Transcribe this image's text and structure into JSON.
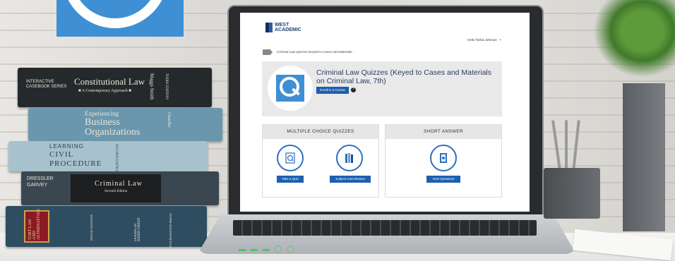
{
  "brand": {
    "line1": "WEST",
    "line2": "ACADEMIC"
  },
  "header": {
    "user_greeting": "Hello Tasha Johnson"
  },
  "breadcrumb": {
    "text": "Criminal Law Quizzes (Keyed to Cases and Materials..."
  },
  "course": {
    "title": "Criminal Law Quizzes (Keyed to Cases and Materials on Criminal Law, 7th)",
    "enroll_label": "Enroll in a Course",
    "help_label": "?"
  },
  "panels": {
    "mcq": {
      "title": "MULTIPLE CHOICE QUIZZES",
      "take_quiz_label": "Take a Quiz",
      "review_label": "Subject Area Review"
    },
    "short": {
      "title": "SHORT ANSWER",
      "view_label": "View Questions"
    }
  },
  "books": [
    {
      "series": "INTERACTIVE CASEBOOK SERIES",
      "title": "Constitutional Law",
      "subtitle": "■ A Contemporary Approach ■",
      "authors": "Maggs Smith",
      "edition": "THIRD EDITION"
    },
    {
      "title_line1": "Experiencing",
      "title_line2": "Business",
      "title_line3": "Organizations",
      "authors": "Chandler"
    },
    {
      "title_line1": "LEARNING",
      "title_line2": "CIVIL",
      "title_line3": "PROCEDURE",
      "edition": "SECOND EDITION"
    },
    {
      "authors": "DRESSLER GARVEY",
      "title": "Criminal Law",
      "subtitle": "Seventh Edition"
    },
    {
      "title": "TORT LAW AND ALTERNATIVES",
      "edition": "NINTH EDITION",
      "authors": "FRANKLIN RABIN GREEN",
      "publisher": "FOUNDATION PRESS"
    }
  ],
  "colors": {
    "accent": "#1d5fb0",
    "logo_blue": "#3f8fd4"
  }
}
